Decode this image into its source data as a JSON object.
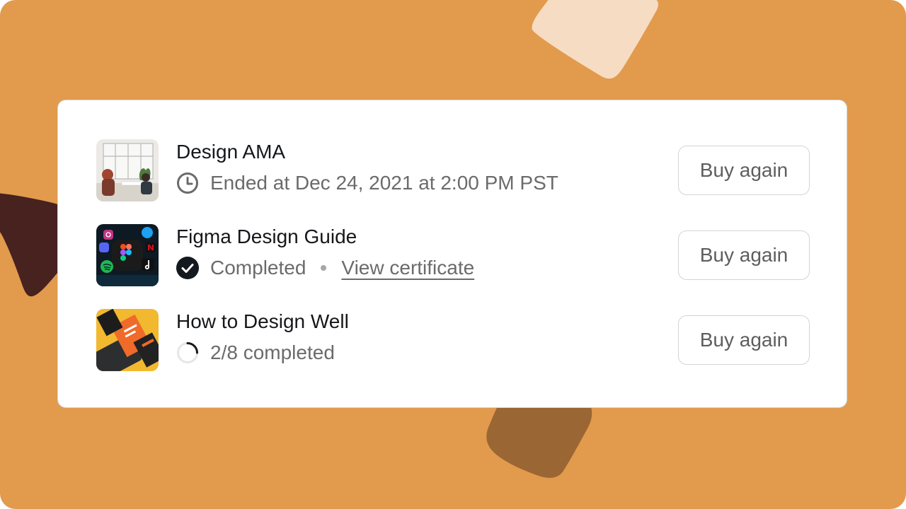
{
  "colors": {
    "background": "#E29A4D",
    "shape_light": "#F6DCC2",
    "shape_dark": "#47221F",
    "shape_brown": "#9A6634",
    "card": "#FFFFFF",
    "title_text": "#15171A",
    "meta_text": "#6B6B6B"
  },
  "orders": [
    {
      "title": "Design AMA",
      "status_icon": "clock-icon",
      "status_text": "Ended at Dec 24, 2021 at 2:00 PM PST",
      "thumbnail": "office-meeting-photo",
      "button_label": "Buy again"
    },
    {
      "title": "Figma Design Guide",
      "status_icon": "check-circle-icon",
      "status_text": "Completed",
      "link_text": "View certificate",
      "thumbnail": "app-icons-photo",
      "button_label": "Buy again"
    },
    {
      "title": "How to Design Well",
      "status_icon": "progress-ring-icon",
      "status_text": "2/8 completed",
      "progress": 0.25,
      "thumbnail": "design-books-photo",
      "button_label": "Buy again"
    }
  ]
}
